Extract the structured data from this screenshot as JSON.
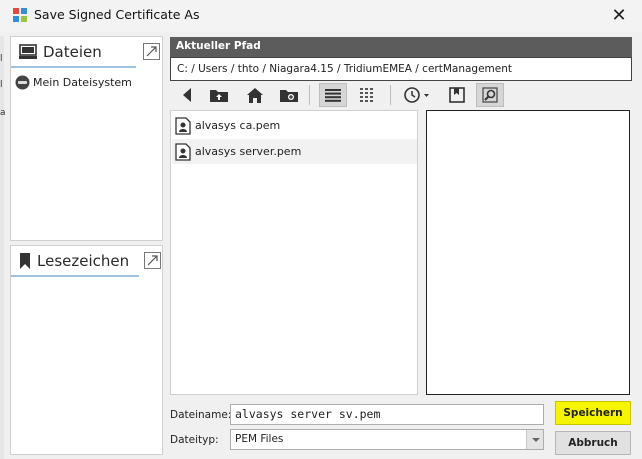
{
  "window": {
    "title": "Save Signed Certificate As"
  },
  "panes": {
    "files_tab": "Dateien",
    "tree_items": [
      {
        "label": "Mein Dateisystem",
        "icon": "drive-icon"
      }
    ],
    "bookmarks_tab": "Lesezeichen"
  },
  "path": {
    "header": "Aktueller Pfad",
    "value": "C: / Users / thto / Niagara4.15 / TridiumEMEA / certManagement"
  },
  "toolbar": {
    "buttons": [
      "back",
      "up-folder",
      "home",
      "new-folder",
      "list-view",
      "details-view",
      "history",
      "bookmark",
      "preview"
    ]
  },
  "files": [
    {
      "name": "alvasys ca.pem",
      "icon": "certificate-icon"
    },
    {
      "name": "alvasys server.pem",
      "icon": "certificate-icon"
    }
  ],
  "form": {
    "filename_label": "Dateiname:",
    "filename_value": "alvasys server sv.pem",
    "filetype_label": "Dateityp:",
    "filetype_value": "PEM Files"
  },
  "buttons": {
    "save": "Speichern",
    "cancel": "Abbruch"
  },
  "colors": {
    "save_highlight": "#f5f500",
    "path_header_bg": "#5c5c5c",
    "tab_underline": "#9ec1de"
  }
}
